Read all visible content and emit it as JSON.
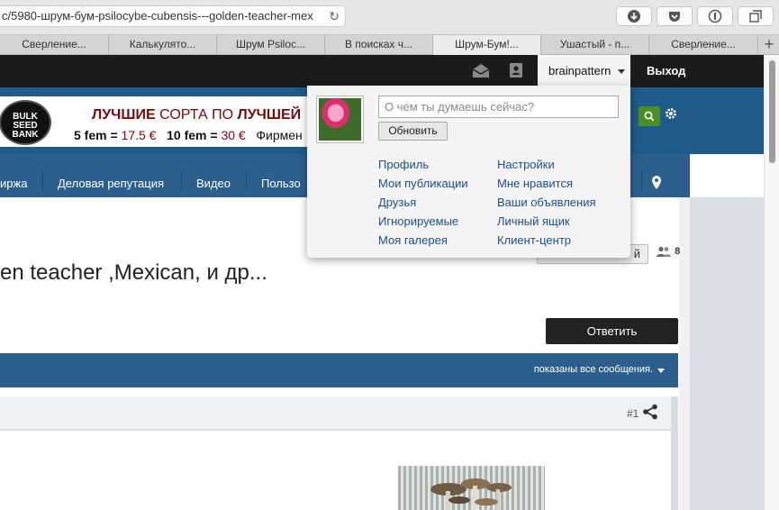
{
  "browser": {
    "url": "c/5980-шрум-бум-psilocybe-cubensis---golden-teacher-mex",
    "tabs": [
      {
        "label": "Сверление...",
        "active": false
      },
      {
        "label": "Калькулято...",
        "active": false
      },
      {
        "label": "Шрум Psiloc...",
        "active": false
      },
      {
        "label": "В поисках ч...",
        "active": false
      },
      {
        "label": "Шрум-Бум!...",
        "active": true
      },
      {
        "label": "Ушастый - п...",
        "active": false
      },
      {
        "label": "Сверление...",
        "active": false
      }
    ],
    "new_tab": "+"
  },
  "topbar": {
    "username": "brainpattern",
    "logout": "Выход"
  },
  "banner": {
    "logo_text": "BULK SEED BANK",
    "line1_a": "ЛУЧШИЕ",
    "line1_b": "СОРТА ПО",
    "line1_c": "ЛУЧШЕЙ",
    "price1_label": "5 fem =",
    "price1_value": "17.5 €",
    "price2_label": "10 fem =",
    "price2_value": "30 €",
    "extra": "Фирмен"
  },
  "nav": {
    "items": [
      "иржа",
      "Деловая репутация",
      "Видео",
      "Пользо"
    ]
  },
  "thread": {
    "title": "en teacher ,Mexican, и др...",
    "watch_label": "й",
    "members_count": "8",
    "reply_label": "Ответить",
    "filter_label": "показаны все сообщения.",
    "post_number": "#1"
  },
  "popup": {
    "status_placeholder": "О чем ты думаешь сейчас?",
    "update_label": "Обновить",
    "links_left": [
      "Профиль",
      "Мои публикации",
      "Друзья",
      "Игнорируемые",
      "Моя галерея"
    ],
    "links_right": [
      "Настройки",
      "Мне нравится",
      "Ваши объявления",
      "Личный ящик",
      "Клиент-центр"
    ]
  }
}
